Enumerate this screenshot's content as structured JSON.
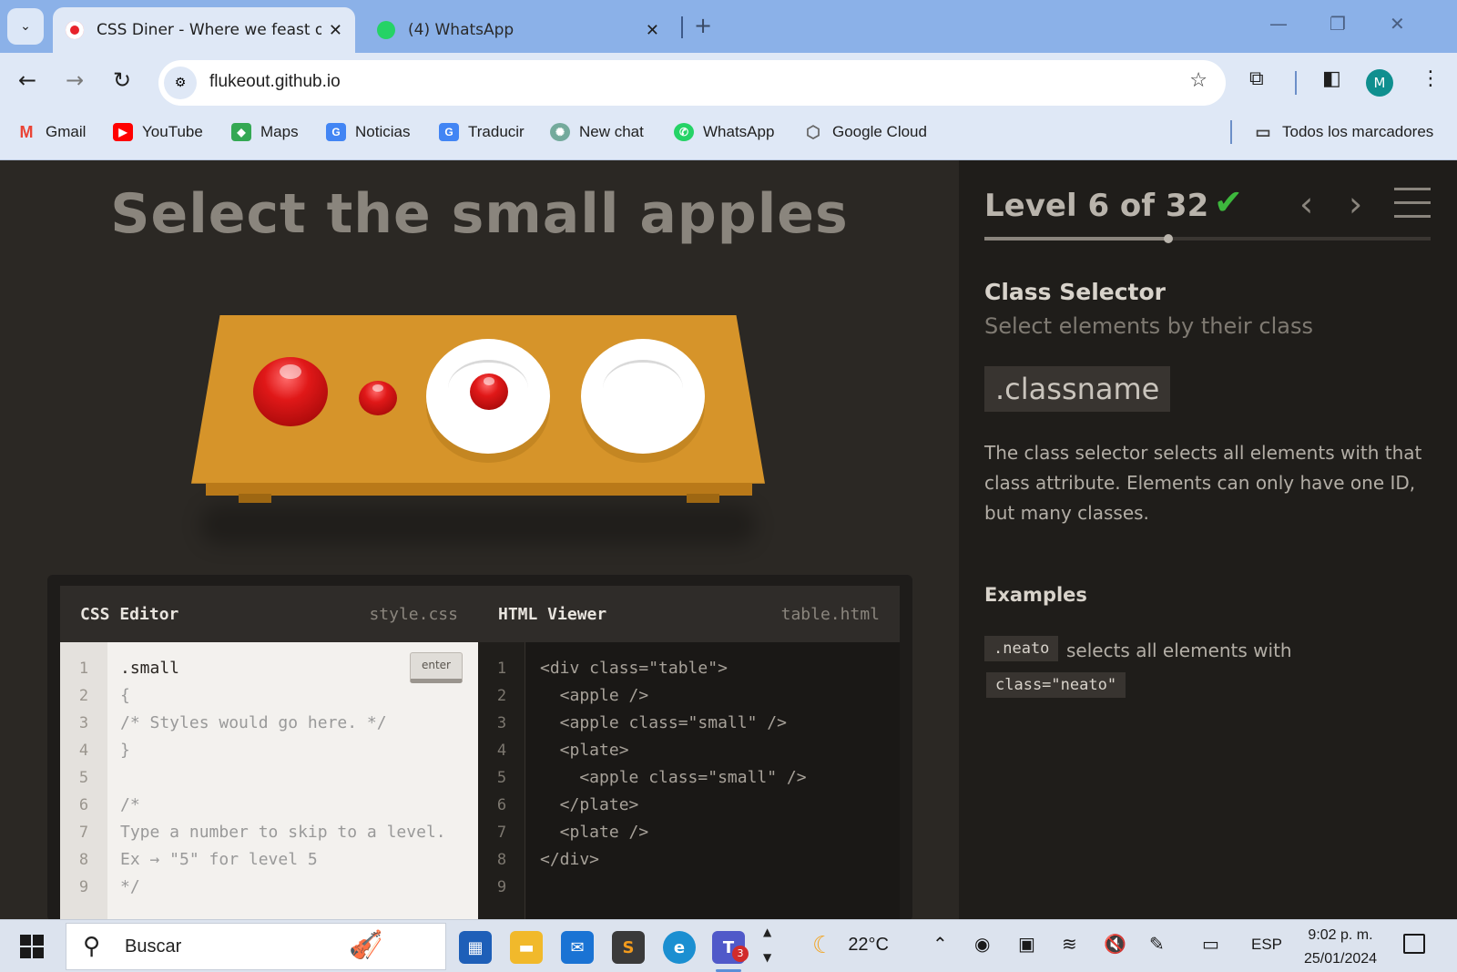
{
  "browser": {
    "tabs": [
      {
        "title": "CSS Diner - Where we feast on CSS Selectors!",
        "active": true
      },
      {
        "title": "(4) WhatsApp",
        "active": false
      }
    ],
    "close_glyph": "✕",
    "new_tab_glyph": "+",
    "address": "flukeout.github.io",
    "profile_initial": "M",
    "bookmarks": [
      "Gmail",
      "YouTube",
      "Maps",
      "Noticias",
      "Traducir",
      "New chat",
      "WhatsApp",
      "Google Cloud"
    ],
    "all_bookmarks": "Todos los marcadores"
  },
  "game": {
    "instruction": "Select the small apples",
    "level_label": "Level 6 of 32",
    "level_current": 6,
    "level_total": 32,
    "completed": true,
    "selector_name": "Class Selector",
    "selector_title": "Select elements by their class",
    "syntax": ".classname",
    "hint": "The class selector selects all elements with that class attribute. Elements can only have one ID, but many classes.",
    "examples_title": "Examples",
    "example": {
      "code1": ".neato",
      "text": "selects all elements with",
      "code2": "class=\"neato\""
    }
  },
  "css_editor": {
    "title": "CSS Editor",
    "file": "style.css",
    "enter_label": "enter",
    "line_numbers": [
      "1",
      "2",
      "3",
      "4",
      "5",
      "6",
      "7",
      "8",
      "9"
    ],
    "lines": [
      ".small",
      "{",
      "/* Styles would go here. */",
      "}",
      "",
      "/*",
      "Type a number to skip to a level.",
      "Ex → \"5\" for level 5",
      "*/"
    ]
  },
  "html_viewer": {
    "title": "HTML Viewer",
    "file": "table.html",
    "line_numbers": [
      "1",
      "2",
      "3",
      "4",
      "5",
      "6",
      "7",
      "8",
      "9"
    ],
    "lines": [
      "<div class=\"table\">",
      "  <apple />",
      "  <apple class=\"small\" />",
      "  <plate>",
      "    <apple class=\"small\" />",
      "  </plate>",
      "  <plate />",
      "</div>",
      ""
    ]
  },
  "taskbar": {
    "search_placeholder": "Buscar",
    "teams_badge": "3",
    "temperature": "22°C",
    "language": "ESP",
    "time": "9:02 p. m.",
    "date": "25/01/2024"
  },
  "colors": {
    "accent_check": "#3db83d",
    "table": "#d6942a",
    "apple": "#e01818",
    "page_bg": "#2b2824"
  }
}
